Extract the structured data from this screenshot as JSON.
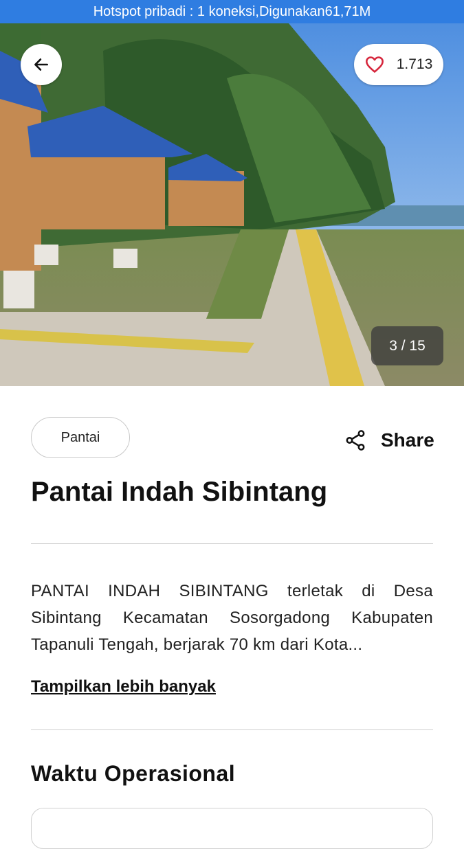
{
  "status_bar": {
    "text": "Hotspot pribadi : 1 koneksi,Digunakan61,71M"
  },
  "hero": {
    "like_count": "1.713",
    "photo_counter": "3 / 15",
    "icons": {
      "back": "arrow-left-icon",
      "like": "heart-outline-icon"
    }
  },
  "details": {
    "category": "Pantai",
    "share_label": "Share",
    "share_icon": "share-icon",
    "title": "Pantai Indah Sibintang",
    "description": "PANTAI INDAH SIBINTANG terletak di Desa Sibintang Kecamatan Sosorgadong Kabupaten Tapanuli Tengah, berjarak 70 km dari Kota...",
    "show_more": "Tampilkan lebih banyak"
  },
  "operational": {
    "title": "Waktu Operasional"
  },
  "colors": {
    "status_bar": "#2f7de1",
    "heart": "#d6263c"
  }
}
